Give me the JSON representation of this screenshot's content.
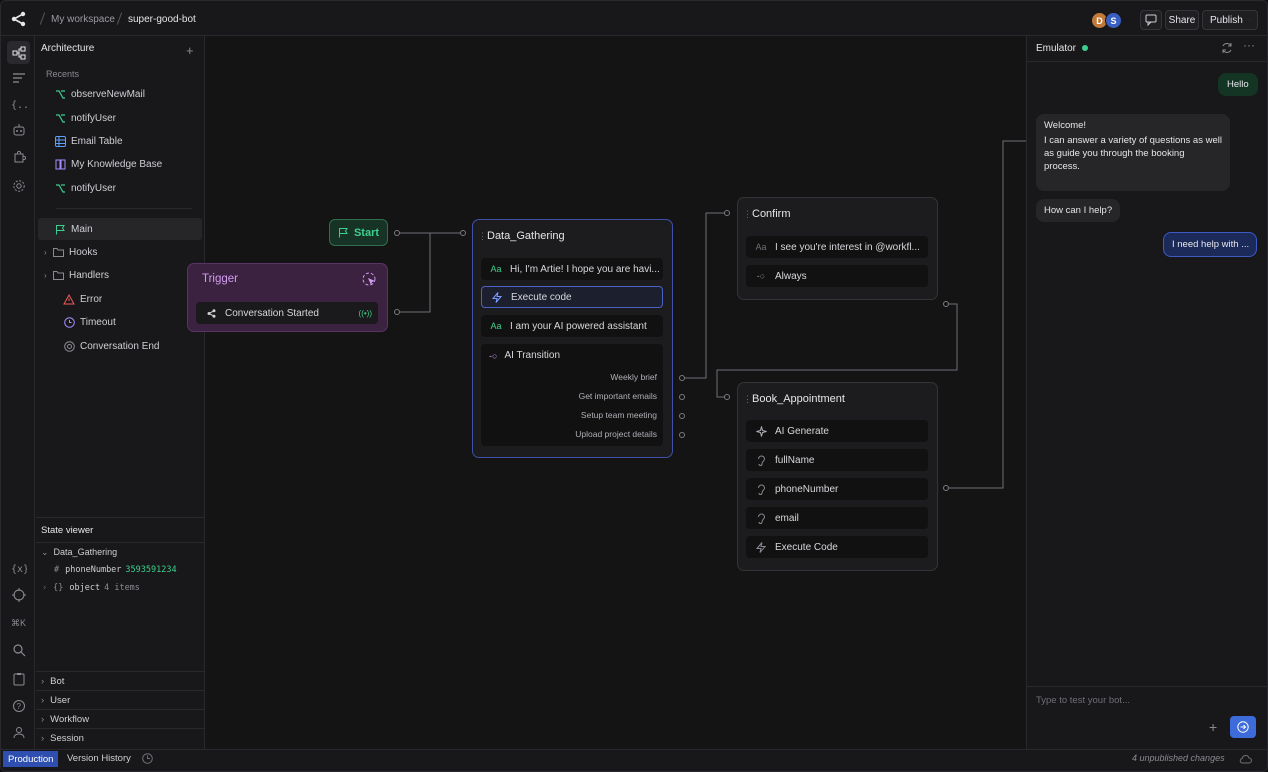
{
  "topbar": {
    "workspace": "My workspace",
    "bot_name": "super-good-bot",
    "avatars": [
      "D",
      "S"
    ],
    "share_label": "Share",
    "publish_label": "Publish"
  },
  "left_panel": {
    "title": "Architecture",
    "recents_label": "Recents",
    "recents": [
      {
        "label": "observeNewMail",
        "icon": "workflow-icon"
      },
      {
        "label": "notifyUser",
        "icon": "workflow-icon"
      },
      {
        "label": "Email Table",
        "icon": "table-icon"
      },
      {
        "label": "My Knowledge Base",
        "icon": "book-icon"
      },
      {
        "label": "notifyUser",
        "icon": "workflow-icon"
      }
    ],
    "tree": [
      {
        "label": "Main",
        "icon": "flag-icon"
      },
      {
        "label": "Hooks",
        "icon": "folder-icon"
      },
      {
        "label": "Handlers",
        "icon": "folder-icon"
      },
      {
        "label": "Error",
        "icon": "warning-icon"
      },
      {
        "label": "Timeout",
        "icon": "clock-icon"
      },
      {
        "label": "Conversation End",
        "icon": "target-icon"
      }
    ]
  },
  "state_viewer": {
    "title": "State viewer",
    "group": "Data_Gathering",
    "vars": [
      {
        "type": "#",
        "name": "phoneNumber",
        "value": "3593591234"
      },
      {
        "type": "{}",
        "name": "object",
        "value": "4 items"
      }
    ],
    "sections": [
      "Bot",
      "User",
      "Workflow",
      "Session"
    ]
  },
  "rail": {
    "shortcut": "⌘K"
  },
  "canvas": {
    "start": {
      "label": "Start"
    },
    "trigger": {
      "title": "Trigger",
      "row": "Conversation Started"
    },
    "data_gathering": {
      "title": "Data_Gathering",
      "rows": [
        "Hi, I'm Artie! I hope you are havi...",
        "Execute code",
        "I am your AI powered assistant",
        "AI Transition"
      ],
      "transitions": [
        "Weekly brief",
        "Get important emails",
        "Setup team meeting",
        "Upload project details"
      ]
    },
    "confirm": {
      "title": "Confirm",
      "rows": [
        "I see you're interest in @workfl...",
        "Always"
      ]
    },
    "book": {
      "title": "Book_Appointment",
      "rows": [
        "AI Generate",
        "fullName",
        "phoneNumber",
        "email",
        "Execute Code"
      ]
    }
  },
  "emulator": {
    "title": "Emulator",
    "status_color": "#3ecf8e",
    "msg_user_1": "Hello",
    "msg_bot_1_title": "Welcome!",
    "msg_bot_1_body": "I can answer a variety of questions as well as guide you through the booking process.",
    "msg_bot_2": "How can I help?",
    "msg_user_2": "I need help with ...",
    "input_placeholder": "Type to test your bot..."
  },
  "statusbar": {
    "production": "Production",
    "version_history": "Version History",
    "unpublished": "4 unpublished changes"
  },
  "colors": {
    "accent": "#3d6bd9",
    "start_green": "#3ecf8e",
    "trigger_purple": "#4a2a55"
  }
}
